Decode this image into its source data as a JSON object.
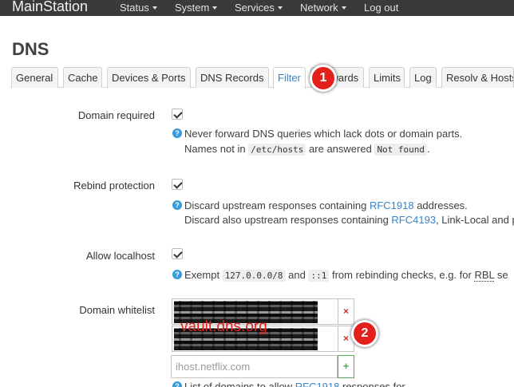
{
  "navbar": {
    "brand": "MainStation",
    "items": [
      {
        "label": "Status",
        "dropdown": true
      },
      {
        "label": "System",
        "dropdown": true
      },
      {
        "label": "Services",
        "dropdown": true
      },
      {
        "label": "Network",
        "dropdown": true
      },
      {
        "label": "Log out",
        "dropdown": false
      }
    ]
  },
  "page": {
    "title": "DNS",
    "tabs": [
      {
        "label": "General",
        "active": false
      },
      {
        "label": "Cache",
        "active": false
      },
      {
        "label": "Devices & Ports",
        "active": false
      },
      {
        "label": "DNS Records",
        "active": false
      },
      {
        "label": "Filter",
        "active": true
      },
      {
        "label": "Forwards",
        "active": false
      },
      {
        "label": "Limits",
        "active": false
      },
      {
        "label": "Log",
        "active": false
      },
      {
        "label": "Resolv & Hosts Files",
        "active": false
      }
    ]
  },
  "fields": {
    "domain_required": {
      "label": "Domain required",
      "checked": true,
      "desc_line1": "Never forward DNS queries which lack dots or domain parts.",
      "desc_line2_pre": "Names not in ",
      "desc_line2_code1": "/etc/hosts",
      "desc_line2_mid": " are answered ",
      "desc_line2_code2": "Not found",
      "desc_line2_post": "."
    },
    "rebind_protection": {
      "label": "Rebind protection",
      "checked": true,
      "desc_line1_pre": "Discard upstream responses containing ",
      "desc_line1_link": "RFC1918",
      "desc_line1_post": " addresses.",
      "desc_line2_pre": "Discard also upstream responses containing ",
      "desc_line2_link": "RFC4193",
      "desc_line2_post": ", Link-Local and p"
    },
    "allow_localhost": {
      "label": "Allow localhost",
      "checked": true,
      "desc_pre": "Exempt ",
      "desc_code1": "127.0.0.0/8",
      "desc_mid": " and ",
      "desc_code2": "::1",
      "desc_post": " from rebinding checks, e.g. for ",
      "desc_abbr": "RBL",
      "desc_tail": " se"
    },
    "domain_whitelist": {
      "label": "Domain whitelist",
      "entry_remove_label": "×",
      "add_placeholder": "ihost.netflix.com",
      "add_label": "+",
      "help_pre": "List of domains to allow ",
      "help_link": "RFC1918",
      "help_post": " responses for."
    }
  },
  "annotations": {
    "overlay_text": "vault.dns.org",
    "markers": [
      "1",
      "2"
    ]
  },
  "colors": {
    "navbar_bg": "#3a3a3a",
    "link": "#3a83c6",
    "annotation_red": "#e3201b",
    "remove_red": "#c9302c",
    "add_green": "#4cae4c",
    "help_blue": "#3a9bd8"
  }
}
